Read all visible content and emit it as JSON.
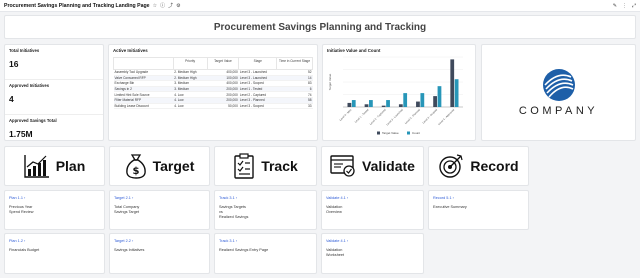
{
  "topbar": {
    "title": "Procurement Savings Planning and Tracking Landing Page"
  },
  "banner": {
    "title": "Procurement Savings Planning and Tracking"
  },
  "kpis": [
    {
      "label": "Total Initiatives",
      "value": "16"
    },
    {
      "label": "Approved Initiatives",
      "value": "4"
    },
    {
      "label": "Approved Savings Total",
      "value": "1.75M"
    }
  ],
  "table": {
    "title": "Active Initiatives",
    "headers": [
      "",
      "Priority",
      "Target Value",
      "Stage",
      "Time in Current Stage"
    ],
    "rows": [
      [
        "Assembly Tool Upgrade",
        "2. Medium High",
        "400,000",
        "Level 3 - Launched",
        "52"
      ],
      [
        "Valve Consumed RFP",
        "2. Medium High",
        "100,000",
        "Level 3 - Launched",
        "14"
      ],
      [
        "Exchange Bin",
        "3. Medium",
        "400,000",
        "Level 3 - Scoped",
        "83"
      ],
      [
        "Savings in 2",
        "3. Medium",
        "200,000",
        "Level 1 - Tested",
        "6"
      ],
      [
        "Limited Hint Sole Source",
        "4. Low",
        "200,000",
        "Level 2 - Captured",
        "74"
      ],
      [
        "Filter Material RFP",
        "4. Low",
        "200,000",
        "Level 3 - Planned",
        "58"
      ],
      [
        "Building Lease Discount",
        "4. Low",
        "50,000",
        "Level 3 - Scoped",
        "33"
      ]
    ]
  },
  "chart_data": {
    "type": "bar",
    "title": "Initiative Value and Count",
    "ylabel": "Target Value",
    "categories": [
      "Level 0 - Idea",
      "Level 1 - Tested",
      "Level 2 - Captured",
      "Level 3 - Launched",
      "Level 3 - Planned",
      "Level 3 - Scoped",
      "Level 4 - Approved"
    ],
    "series": [
      {
        "name": "Target Value",
        "color": "#3f4a5c",
        "values": [
          0.15,
          0.1,
          0.05,
          0.1,
          0.2,
          0.4,
          1.75
        ]
      },
      {
        "name": "Count",
        "color": "#2796b8",
        "values": [
          1,
          1,
          1,
          2,
          2,
          3,
          4
        ]
      }
    ]
  },
  "logo": {
    "word": "COMPANY",
    "color": "#1e5fa8"
  },
  "tiles": [
    {
      "word": "Plan",
      "icon": "bar-chart-icon"
    },
    {
      "word": "Target",
      "icon": "money-bag-icon"
    },
    {
      "word": "Track",
      "icon": "checklist-icon"
    },
    {
      "word": "Validate",
      "icon": "browser-check-icon"
    },
    {
      "word": "Record",
      "icon": "target-arrow-icon"
    }
  ],
  "links_row1": [
    {
      "link": "Plan 1.1 ›",
      "desc": "Previous Year\nSpend Review"
    },
    {
      "link": "Target 2.1 ›",
      "desc": "Total Company\nSavings Target"
    },
    {
      "link": "Track 3.1 ›",
      "desc": "Savings Targets\nvs\nRealized Savings"
    },
    {
      "link": "Validate 4.1 ›",
      "desc": "Validation\nOverview"
    },
    {
      "link": "Record 5.1 ›",
      "desc": "Executive Summary"
    }
  ],
  "links_row2": [
    {
      "link": "Plan 1.2 ›",
      "desc": "Financials Budget"
    },
    {
      "link": "Target 2.2 ›",
      "desc": "Savings Initiatives"
    },
    {
      "link": "Track 3.1 ›",
      "desc": "Realized Savings Entry Page"
    },
    {
      "link": "Validate 4.1 ›",
      "desc": "Validation\nWorksheet"
    }
  ]
}
